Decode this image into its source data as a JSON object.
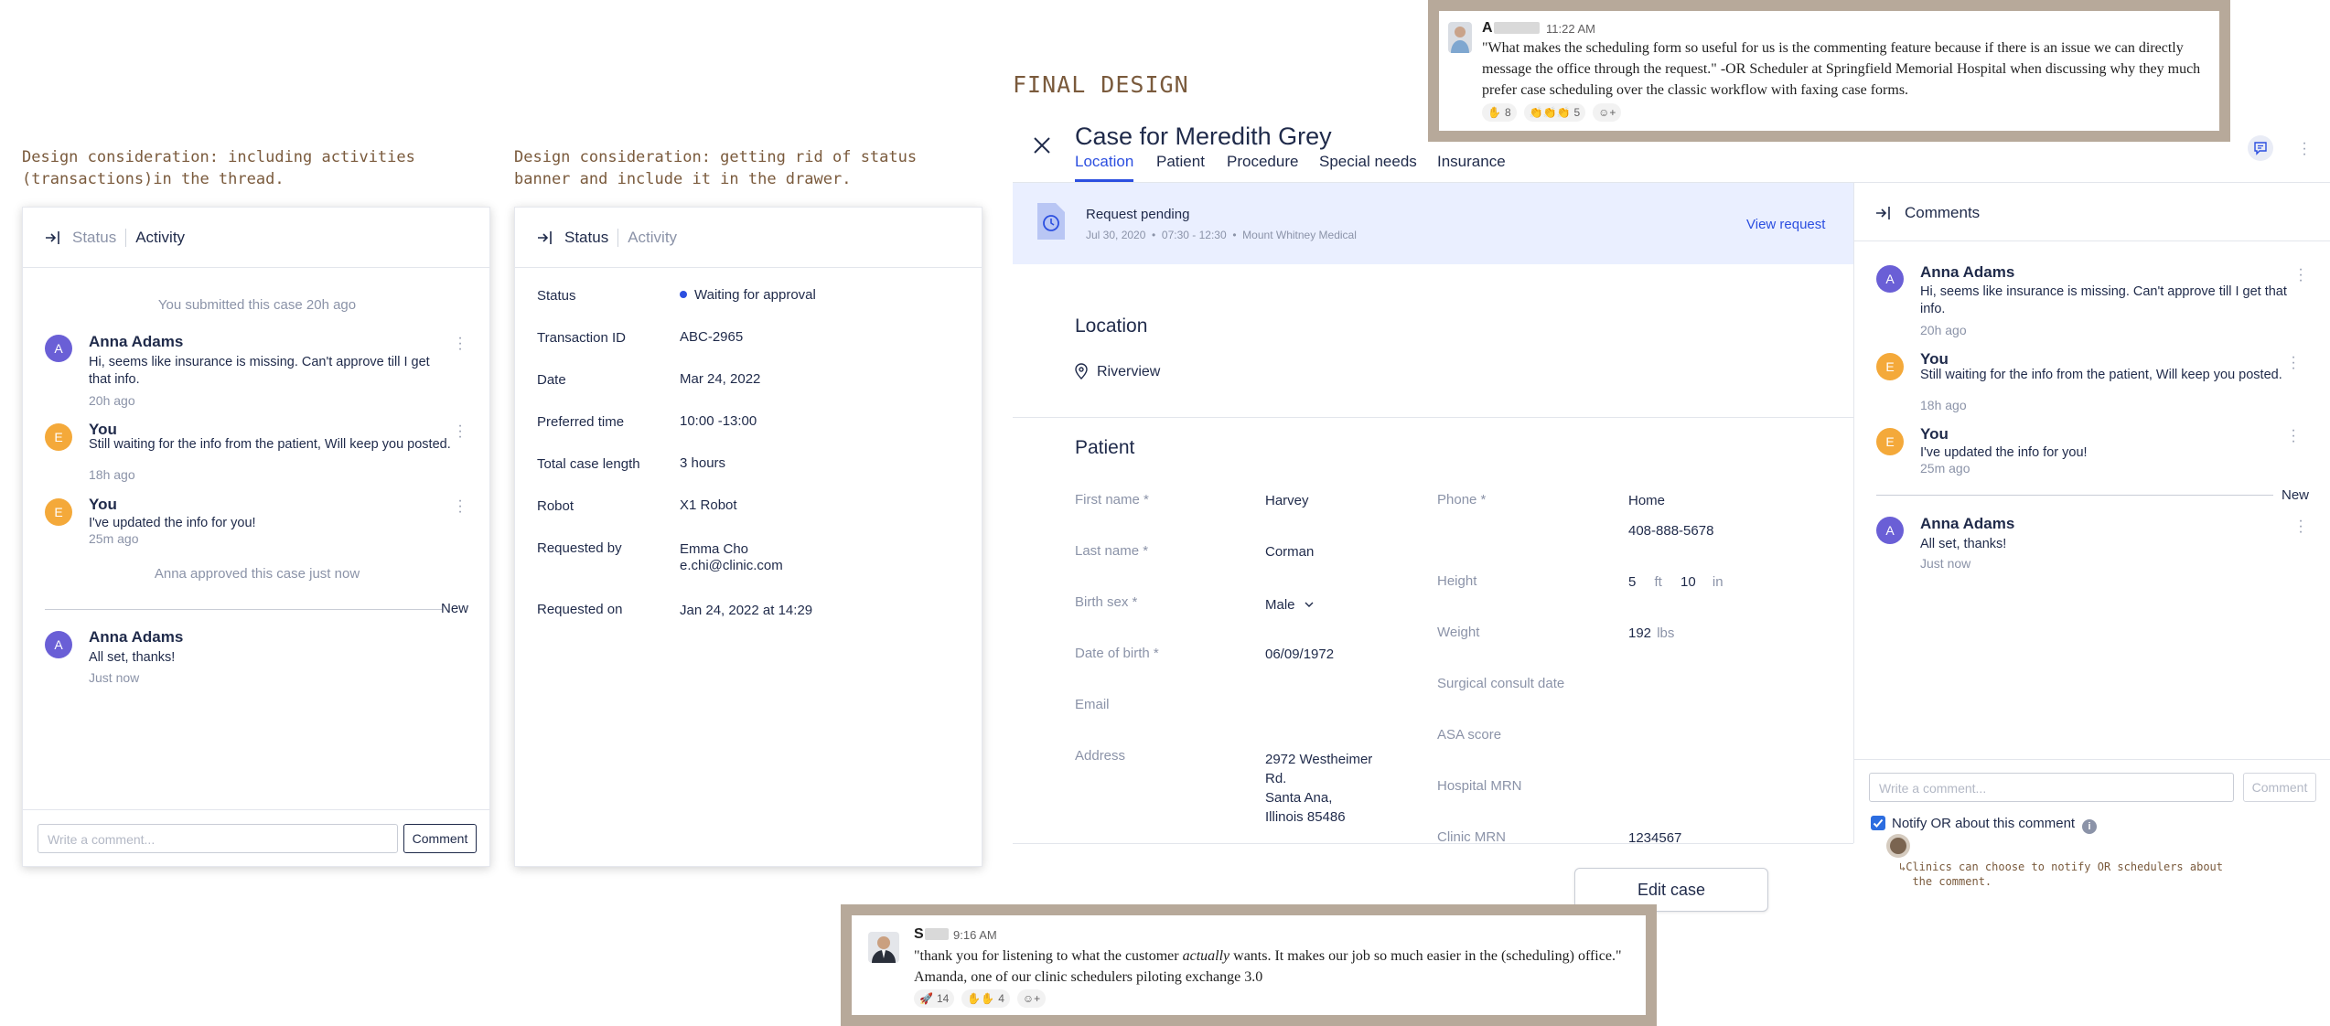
{
  "notes": {
    "activity_note": "Design consideration: including activities\n(transactions)in the thread.",
    "status_note": "Design consideration: getting rid of status\nbanner and include it in the drawer.",
    "final_label": "FINAL DESIGN",
    "notify_note": "↳Clinics can choose to notify OR schedulers about\n  the comment."
  },
  "activity_panel": {
    "tab_status": "Status",
    "tab_activity": "Activity",
    "system_submitted": "You submitted this case 20h ago",
    "comments": [
      {
        "initial": "A",
        "name": "Anna Adams",
        "body": "Hi, seems like insurance is missing. Can't approve till I get that info.",
        "time": "20h ago"
      },
      {
        "initial": "E",
        "name": "You",
        "body": "Still waiting for the info from the patient, Will keep you posted.",
        "time": "18h ago"
      },
      {
        "initial": "E",
        "name": "You",
        "body": "I've updated the info for you!",
        "time": "25m ago"
      }
    ],
    "system_approved": "Anna approved this case just now",
    "new_label": "New",
    "new_comment": {
      "initial": "A",
      "name": "Anna Adams",
      "body": "All set, thanks!",
      "time": "Just now"
    },
    "input_placeholder": "Write a comment...",
    "comment_button": "Comment"
  },
  "status_panel": {
    "tab_status": "Status",
    "tab_activity": "Activity",
    "rows": [
      {
        "label": "Status",
        "value": "Waiting for approval"
      },
      {
        "label": "Transaction ID",
        "value": "ABC-2965"
      },
      {
        "label": "Date",
        "value": "Mar 24, 2022"
      },
      {
        "label": "Preferred time",
        "value": "10:00 -13:00"
      },
      {
        "label": "Total case length",
        "value": "3 hours"
      },
      {
        "label": "Robot",
        "value": "X1 Robot"
      },
      {
        "label": "Requested by",
        "value": "Emma Cho",
        "value2": "e.chi@clinic.com"
      },
      {
        "label": "Requested on",
        "value": "Jan 24, 2022 at 14:29"
      }
    ]
  },
  "case": {
    "title": "Case for Meredith Grey",
    "tabs": [
      "Location",
      "Patient",
      "Procedure",
      "Special needs",
      "Insurance"
    ],
    "banner": {
      "title": "Request pending",
      "meta": "Jul 30, 2020  •  07:30 - 12:30  •  Mount Whitney Medical",
      "link": "View request"
    },
    "location_title": "Location",
    "location_value": "Riverview",
    "patient_title": "Patient",
    "fields_left": [
      {
        "label": "First name *",
        "value": "Harvey"
      },
      {
        "label": "Last name *",
        "value": "Corman"
      },
      {
        "label": "Birth sex *",
        "value": "Male"
      },
      {
        "label": "Date of birth *",
        "value": "06/09/1972"
      },
      {
        "label": "Email",
        "value": ""
      },
      {
        "label": "Address",
        "value": "2972 Westheimer\nRd.\nSanta Ana,\nIllinois 85486"
      }
    ],
    "fields_right": [
      {
        "label": "Phone *",
        "value": "Home",
        "value2": "408-888-5678"
      },
      {
        "label": "Height",
        "ft": "5",
        "ft_unit": "ft",
        "in": "10",
        "in_unit": "in"
      },
      {
        "label": "Weight",
        "value": "192",
        "unit": "lbs"
      },
      {
        "label": "Surgical consult date",
        "value": ""
      },
      {
        "label": "ASA score",
        "value": ""
      },
      {
        "label": "Hospital MRN",
        "value": ""
      },
      {
        "label": "Clinic MRN",
        "value": "1234567"
      }
    ],
    "edit_button": "Edit case"
  },
  "comments_drawer": {
    "title": "Comments",
    "comments": [
      {
        "initial": "A",
        "name": "Anna Adams",
        "body": "Hi, seems like insurance is missing. Can't approve till I get that info.",
        "time": "20h ago"
      },
      {
        "initial": "E",
        "name": "You",
        "body": "Still waiting for the info from the patient, Will keep you posted.",
        "time": "18h ago"
      },
      {
        "initial": "E",
        "name": "You",
        "body": "I've updated the info for you!",
        "time": "25m ago"
      }
    ],
    "new_label": "New",
    "new_comment": {
      "initial": "A",
      "name": "Anna Adams",
      "body": "All set, thanks!",
      "time": "Just now"
    },
    "input_placeholder": "Write a comment...",
    "comment_button": "Comment",
    "notify_label": "Notify OR about this comment"
  },
  "quote_top": {
    "name": "A",
    "time": "11:22 AM",
    "text": "\"What makes the scheduling form so useful for us is the commenting feature because if there is an issue we can directly message the office through the request.\"  -OR Scheduler at Springfield Memorial Hospital when discussing why they much prefer case scheduling over the classic workflow with faxing case forms.",
    "reactions": [
      "8",
      "5"
    ]
  },
  "quote_bottom": {
    "name": "S",
    "time": "9:16 AM",
    "text_before": "\"thank you for listening to what the customer ",
    "text_em": "actually",
    "text_after": " wants. It makes our job so much easier in the (scheduling) office.\"",
    "text_line2": "Amanda, one of our clinic schedulers piloting exchange 3.0",
    "reactions": [
      "14",
      "4"
    ]
  },
  "colors": {
    "accent": "#2c4fe0",
    "note_brown": "#7a5a3c",
    "frame": "#b7a99a",
    "avatar_purple": "#6a5fd6",
    "avatar_orange": "#f4a93a"
  }
}
